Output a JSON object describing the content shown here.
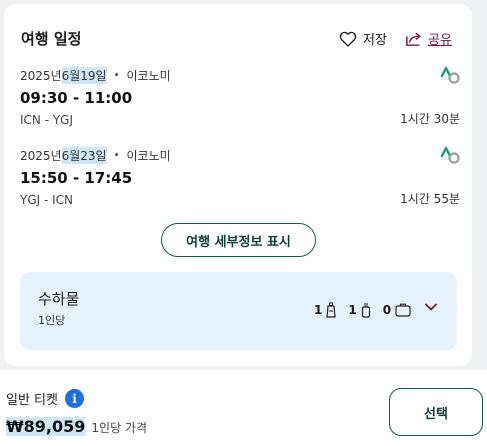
{
  "itinerary": {
    "title": "여행 일정",
    "save_label": "저장",
    "share_label": "공유"
  },
  "flights": [
    {
      "date_prefix": "2025년",
      "date_highlight": "6월19일",
      "cabin": "이코노미",
      "time": "09:30 - 11:00",
      "route": "ICN - YGJ",
      "duration": "1시간 30분"
    },
    {
      "date_prefix": "2025년",
      "date_highlight": "6월23일",
      "cabin": "이코노미",
      "time": "15:50 - 17:45",
      "route": "YGJ - ICN",
      "duration": "1시간 55분"
    }
  ],
  "details_button": "여행 세부정보 표시",
  "baggage": {
    "title": "수하물",
    "subtitle": "1인당",
    "personal_item": "1",
    "carry_on": "1",
    "checked": "0"
  },
  "fare": {
    "label": "일반 티켓",
    "price": "₩89,059",
    "per_person": "1인당 가격",
    "select_label": "선택"
  },
  "colors": {
    "accent": "#0e5e4a",
    "share": "#7a1436",
    "info": "#1e6fd9",
    "baggage_bg": "#e5f2fb",
    "highlight": "#cfe6f5"
  }
}
